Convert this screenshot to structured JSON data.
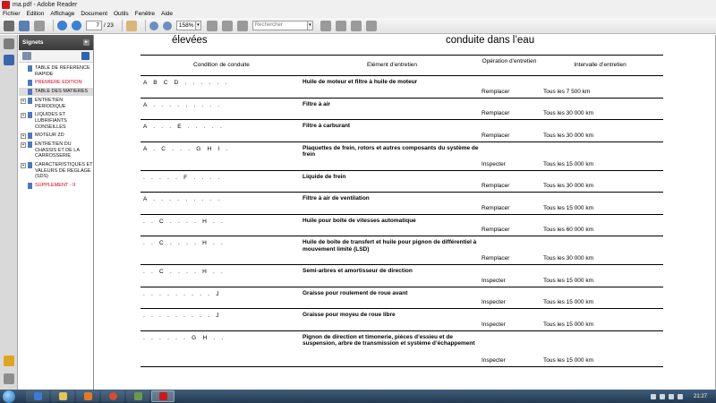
{
  "window": {
    "title": "ma.pdf - Adobe Reader"
  },
  "menu": [
    "Fichier",
    "Edition",
    "Affichage",
    "Document",
    "Outils",
    "Fenêtre",
    "Aide"
  ],
  "toolbar": {
    "page_current": "7",
    "page_total": "/ 23",
    "zoom": "158%",
    "search_placeholder": "Rechercher"
  },
  "bookmarks": {
    "title": "Signets",
    "items": [
      {
        "label": "TABLE DE REFERENCE RAPIDE",
        "expand": "",
        "red": false,
        "selected": false
      },
      {
        "label": "PREMIERE EDITION",
        "expand": "",
        "red": true,
        "selected": false
      },
      {
        "label": "TABLE DES MATIERES",
        "expand": "",
        "red": false,
        "selected": true
      },
      {
        "label": "ENTRETIEN PERIODIQUE",
        "expand": "+",
        "red": false,
        "selected": false
      },
      {
        "label": "LIQUIDES ET LUBRIFIANTS CONSEILLES",
        "expand": "+",
        "red": false,
        "selected": false
      },
      {
        "label": "MOTEUR ZD",
        "expand": "+",
        "red": false,
        "selected": false
      },
      {
        "label": "ENTRETIEN DU CHASSIS ET DE LA CARROSSERIE",
        "expand": "+",
        "red": false,
        "selected": false
      },
      {
        "label": "CARACTERISTIQUES ET VALEURS DE REGLAGE (SDS)",
        "expand": "+",
        "red": false,
        "selected": false
      },
      {
        "label": "SUPPLEMENT - II",
        "expand": "",
        "red": true,
        "selected": false
      }
    ]
  },
  "document": {
    "heading_left": "élevées",
    "heading_right": "conduite dans l’eau",
    "columns": {
      "condition": "Condition de conduite",
      "element": "Elément d’entretien",
      "operation": "Opération d’entretien",
      "interval": "Intervalle d’entretien"
    },
    "rows": [
      {
        "cond": "A    B    C    D    .    .    .    .    .    .",
        "element": "Huile de moteur et filtre à huile de moteur",
        "operation": "Remplacer",
        "interval": "Tous les 7 500 km"
      },
      {
        "cond": "A    .    .    .    .    .    .    .    .    .",
        "element": "Filtre à air",
        "operation": "Remplacer",
        "interval": "Tous les 30 000 km"
      },
      {
        "cond": "A    .    .    .    E    .    .    .    .    .",
        "element": "Filtre à carburant",
        "operation": "Remplacer",
        "interval": "Tous les 30 000 km"
      },
      {
        "cond": "A    .    C    .    .    .    G    H    I    .",
        "element": "Plaquettes de frein, rotors et autres composants du système de frein",
        "operation": "Inspecter",
        "interval": "Tous les 15 000 km"
      },
      {
        "cond": ".    .    .    .    .    F    .    .    .    .",
        "element": "Liquide de frein",
        "operation": "Remplacer",
        "interval": "Tous les 30 000 km"
      },
      {
        "cond": "A    .    .    .    .    .    .    .    .    .",
        "element": "Filtre à air de ventilation",
        "operation": "Remplacer",
        "interval": "Tous les 15 000 km"
      },
      {
        "cond": ".    .    C    .    .    .    .    H    .    .",
        "element": "Huile pour boîte de vitesses automatique",
        "operation": "Remplacer",
        "interval": "Tous les 60 000 km"
      },
      {
        "cond": ".    .    C    .    .    .    .    H    .    .",
        "element": "Huile de boîte de transfert et huile pour pignon de différentiel à mouvement limité (LSD)",
        "operation": "Remplacer",
        "interval": "Tous les 30 000 km"
      },
      {
        "cond": ".    .    C    .    .    .    .    H    .    .",
        "element": "Semi-arbres et amortisseur de direction",
        "operation": "Inspecter",
        "interval": "Tous les 15 000 km"
      },
      {
        "cond": ".    .    .    .    .    .    .    .    .    J",
        "element": "Graisse pour roulement de roue avant",
        "operation": "Inspecter",
        "interval": "Tous les 15 000 km"
      },
      {
        "cond": ".    .    .    .    .    .    .    .    .    J",
        "element": "Graisse pour moyeu de roue libre",
        "operation": "Inspecter",
        "interval": "Tous les 15 000 km"
      },
      {
        "cond": ".    .    .    .    .    .    G    H    .    .",
        "element": "Pignon de direction et timonerie, pièces d’essieu et de suspension, arbre de transmission et système d’échappement",
        "operation": "Inspecter",
        "interval": "Tous les 15 000 km"
      }
    ]
  },
  "taskbar": {
    "clock": "21:27"
  }
}
